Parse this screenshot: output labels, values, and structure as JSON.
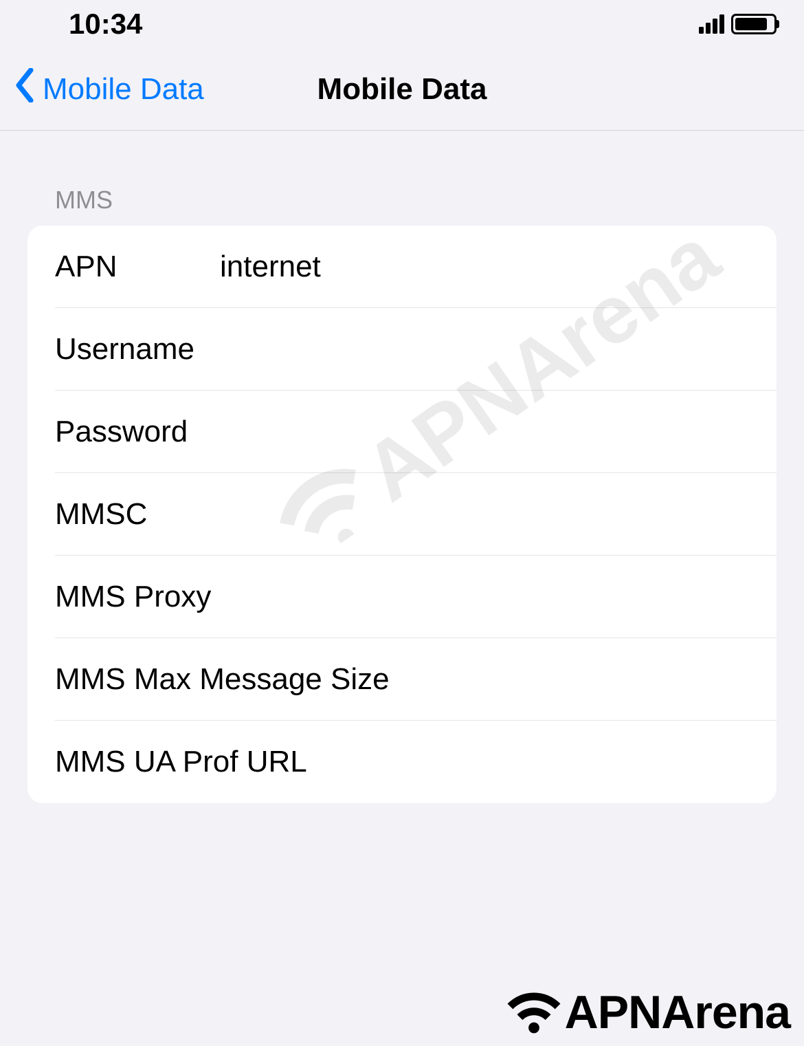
{
  "status": {
    "time": "10:34"
  },
  "nav": {
    "back_label": "Mobile Data",
    "title": "Mobile Data"
  },
  "section": {
    "header": "MMS"
  },
  "fields": {
    "apn": {
      "label": "APN",
      "value": "internet"
    },
    "username": {
      "label": "Username",
      "value": ""
    },
    "password": {
      "label": "Password",
      "value": ""
    },
    "mmsc": {
      "label": "MMSC",
      "value": ""
    },
    "mms_proxy": {
      "label": "MMS Proxy",
      "value": ""
    },
    "mms_max": {
      "label": "MMS Max Message Size",
      "value": ""
    },
    "mms_ua": {
      "label": "MMS UA Prof URL",
      "value": ""
    }
  },
  "watermark": "APNArena",
  "footer": "APNArena"
}
